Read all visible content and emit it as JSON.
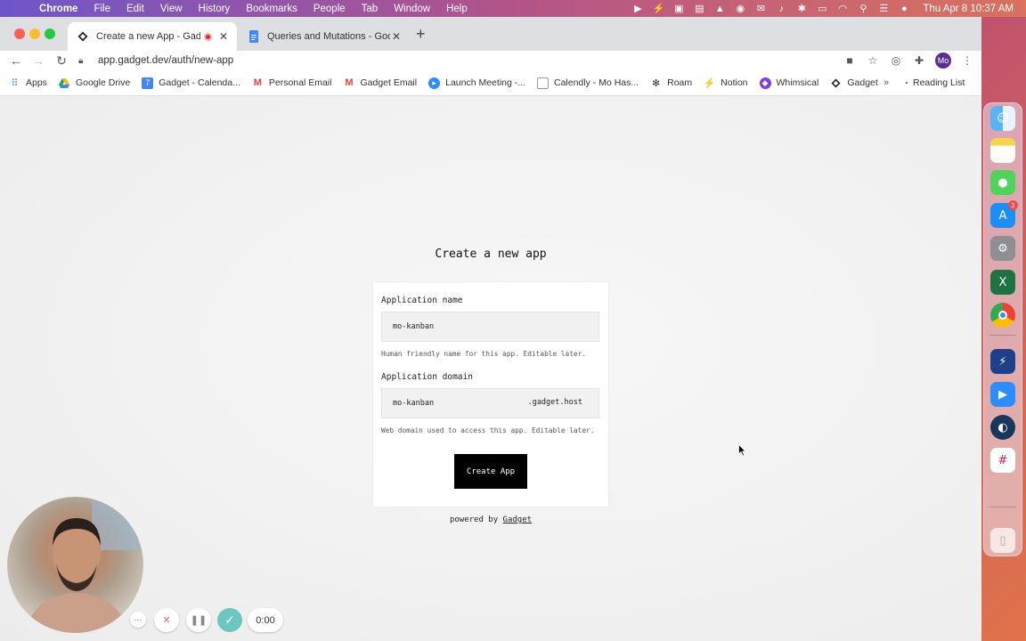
{
  "menubar": {
    "app_name": "Chrome",
    "menus": [
      "File",
      "Edit",
      "View",
      "History",
      "Bookmarks",
      "People",
      "Tab",
      "Window",
      "Help"
    ],
    "clock": "Thu Apr 8  10:37 AM"
  },
  "browser": {
    "tabs": [
      {
        "title": "Create a new App - Gadget",
        "active": true,
        "recording": true
      },
      {
        "title": "Queries and Mutations - Goog",
        "active": false
      }
    ],
    "url": "app.gadget.dev/auth/new-app",
    "profile_initials": "Mo",
    "bookmarks": [
      {
        "label": "Apps",
        "icon": "apps-grid-icon",
        "color": "#4285f4"
      },
      {
        "label": "Google Drive",
        "icon": "google-drive-icon",
        "color": "#1fa463"
      },
      {
        "label": "Gadget - Calenda...",
        "icon": "calendar-icon",
        "color": "#4285f4"
      },
      {
        "label": "Personal Email",
        "icon": "gmail-icon",
        "color": "#ea4335"
      },
      {
        "label": "Gadget Email",
        "icon": "gmail-icon",
        "color": "#ea4335"
      },
      {
        "label": "Launch Meeting -...",
        "icon": "zoom-icon",
        "color": "#2d8cff"
      },
      {
        "label": "Calendly - Mo Has...",
        "icon": "page-icon",
        "color": "#9e9e9e"
      },
      {
        "label": "Roam",
        "icon": "roam-icon",
        "color": "#333333"
      },
      {
        "label": "Notion",
        "icon": "bolt-icon",
        "color": "#f9ab00"
      },
      {
        "label": "Whimsical",
        "icon": "whimsical-icon",
        "color": "#7b3fe4"
      },
      {
        "label": "Gadget",
        "icon": "gadget-icon",
        "color": "#222222"
      }
    ],
    "bookmarks_more": "»",
    "reading_list": "Reading List"
  },
  "page": {
    "heading": "Create a new app",
    "name_label": "Application name",
    "name_value": "mo-kanban",
    "name_help": "Human friendly name for this app. Editable later.",
    "domain_label": "Application domain",
    "domain_value": "mo-kanban",
    "domain_suffix": ".gadget.host",
    "domain_help": "Web domain used to access this app. Editable later.",
    "submit_label": "Create App",
    "powered_prefix": "powered by",
    "powered_link": "Gadget"
  },
  "dock": {
    "appstore_badge": "2"
  },
  "recorder": {
    "more_label": "···",
    "timer": "0:00"
  }
}
